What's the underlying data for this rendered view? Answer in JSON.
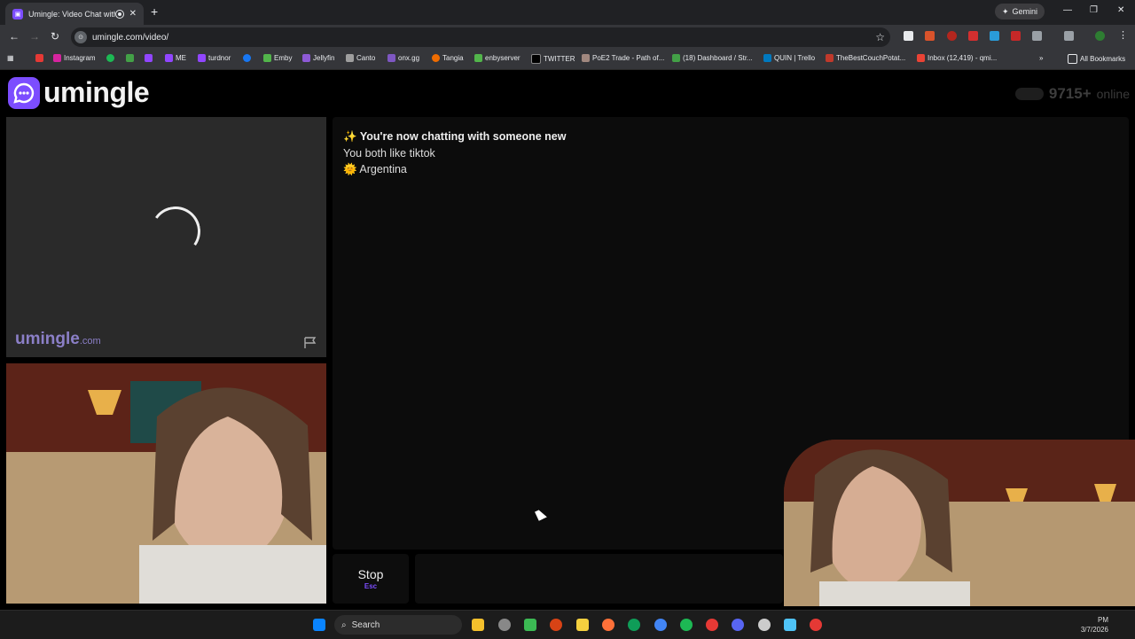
{
  "browser": {
    "tab_title": "Umingle: Video Chat with S",
    "new_tab": "+",
    "gemini_label": "Gemini",
    "url": "umingle.com/video/",
    "bookmarks": [
      "Instagram",
      "ME",
      "turdnor",
      "Emby",
      "Jellyfin",
      "Canto",
      "onx.gg",
      "Tangia",
      "enbyserver",
      "TWITTER",
      "PoE2 Trade - Path of...",
      "(18) Dashboard / Str...",
      "QUIN | Trello",
      "TheBestCouchPotat...",
      "Inbox (12,419) - qmi..."
    ],
    "all_bookmarks": "All Bookmarks"
  },
  "site": {
    "logo_text": "umingle",
    "online_count": "9715+",
    "online_label": "online",
    "watermark": "umingle",
    "watermark_suffix": ".com"
  },
  "chat": {
    "intro_icon": "✨",
    "intro": "You're now chatting with someone new",
    "interest": "You both like tiktok",
    "country_icon": "🌞",
    "country": "Argentina"
  },
  "controls": {
    "stop_label": "Stop",
    "stop_key": "Esc"
  },
  "taskbar": {
    "search_label": "Search",
    "time": "PM",
    "date": "3/7/2026"
  },
  "colors": {
    "accent": "#7c4dff",
    "page_bg": "#000000",
    "chat_bg": "#0c0c0c"
  }
}
